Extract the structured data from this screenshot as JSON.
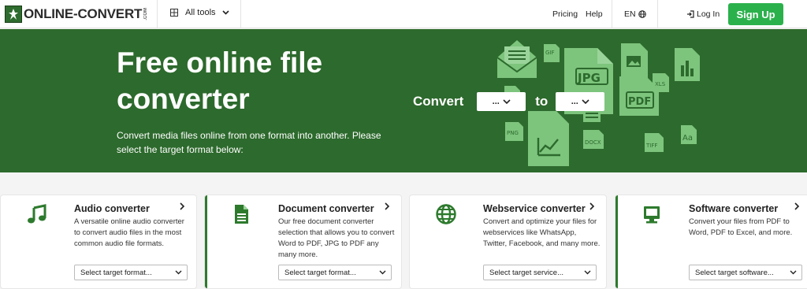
{
  "header": {
    "logo_text": "ONLINE-CONVERT",
    "logo_suffix": ".COM",
    "all_tools_label": "All tools",
    "pricing_label": "Pricing",
    "help_label": "Help",
    "lang_label": "EN",
    "login_label": "Log In",
    "signup_label": "Sign Up"
  },
  "hero": {
    "title": "Free online file converter",
    "subtitle": "Convert media files online from one format into another. Please select the target format below:",
    "convert_label": "Convert",
    "from_value": "...",
    "to_label": "to",
    "to_value": "...",
    "file_labels": [
      "GIF",
      "JPG",
      "XLS",
      "PDF",
      "PNG",
      "DOCX",
      "TIFF"
    ]
  },
  "cards": [
    {
      "title": "Audio converter",
      "desc": "A versatile online audio converter to convert audio files in the most common audio file formats.",
      "select": "Select target format...",
      "icon": "music-note-icon"
    },
    {
      "title": "Document converter",
      "desc": "Our free document converter selection that allows you to convert Word to PDF, JPG to PDF any many more.",
      "select": "Select target format...",
      "icon": "document-icon"
    },
    {
      "title": "Webservice converter",
      "desc": "Convert and optimize your files for webservices like WhatsApp, Twitter, Facebook, and many more.",
      "select": "Select target service...",
      "icon": "globe-icon"
    },
    {
      "title": "Software converter",
      "desc": "Convert your files from PDF to Word, PDF to Excel, and more.",
      "select": "Select target software...",
      "icon": "monitor-icon"
    }
  ],
  "colors": {
    "brand_green": "#2d6a2d",
    "signup_green": "#2bb14c",
    "icon_green": "#7dc47d"
  }
}
